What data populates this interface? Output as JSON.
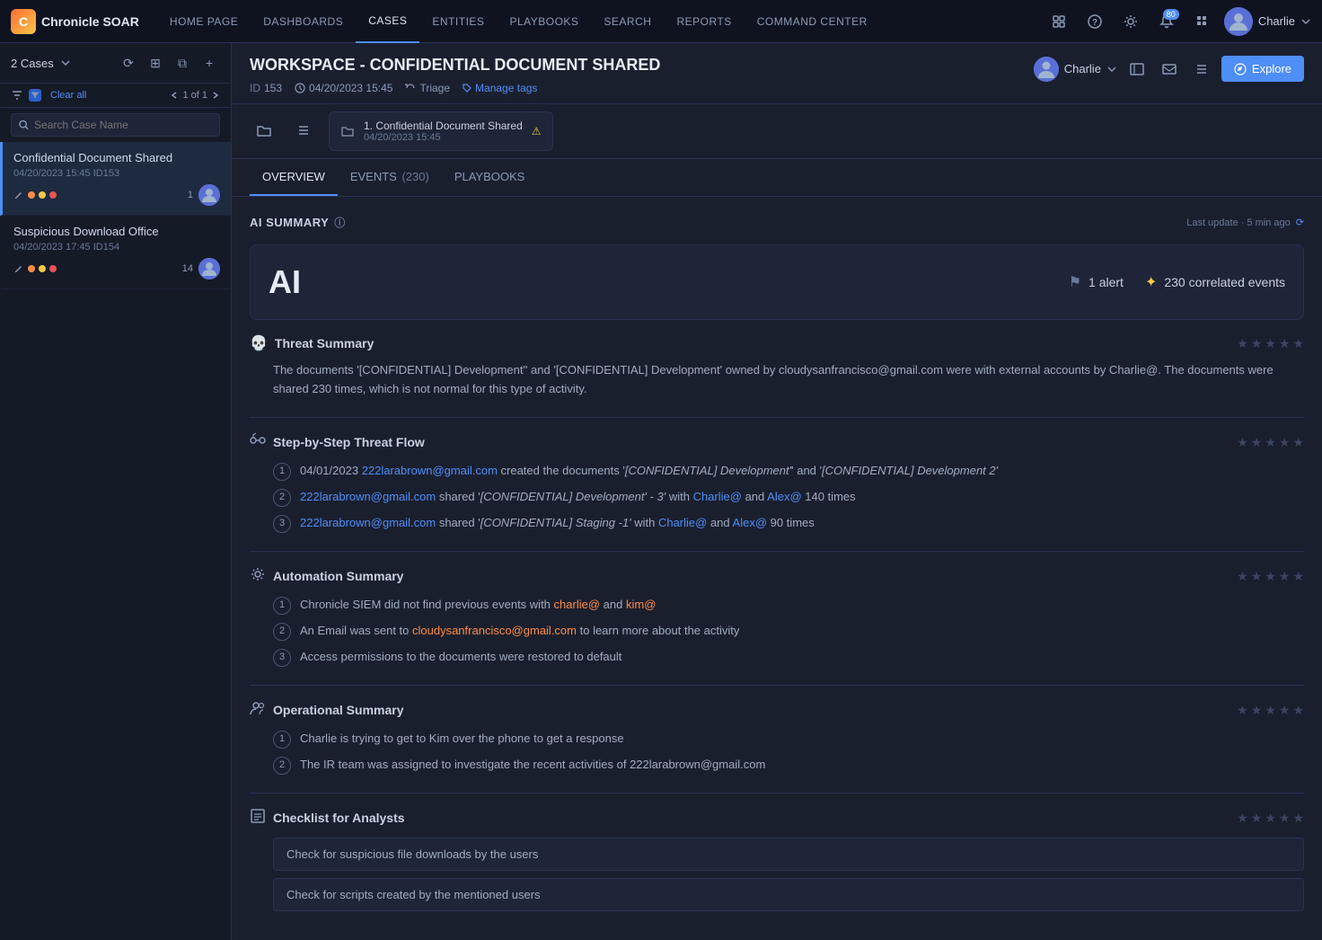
{
  "app": {
    "logo_text": "Chronicle SOAR",
    "logo_abbr": "C"
  },
  "nav": {
    "items": [
      {
        "id": "home",
        "label": "HOME PAGE"
      },
      {
        "id": "dashboards",
        "label": "DASHBOARDS"
      },
      {
        "id": "cases",
        "label": "CASES",
        "active": true
      },
      {
        "id": "entities",
        "label": "ENTITIES"
      },
      {
        "id": "playbooks",
        "label": "PLAYBOOKS"
      },
      {
        "id": "search",
        "label": "SEARCH"
      },
      {
        "id": "reports",
        "label": "REPORTS"
      },
      {
        "id": "command",
        "label": "COMMAND CENTER"
      }
    ],
    "icons": {
      "expand": "⤢",
      "help": "?",
      "settings": "⚙",
      "notifications": "🔔",
      "grid": "⋮⋮",
      "notification_badge": "80"
    },
    "user": {
      "name": "Charlie",
      "avatar_initials": "C"
    }
  },
  "sidebar": {
    "cases_count": "2 Cases",
    "filter_label": "Clear all",
    "pagination": "1 of 1",
    "search_placeholder": "Search Case Name",
    "cases": [
      {
        "title": "Confidential Document Shared",
        "date": "04/20/2023 15:45",
        "id": "ID153",
        "active": true,
        "count": 1,
        "tags": [
          "orange",
          "yellow",
          "red"
        ]
      },
      {
        "title": "Suspicious Download Office",
        "date": "04/20/2023 17:45",
        "id": "ID154",
        "active": false,
        "count": 14,
        "tags": [
          "orange",
          "yellow",
          "red"
        ]
      }
    ]
  },
  "workspace": {
    "title": "WORKSPACE - CONFIDENTIAL DOCUMENT SHARED",
    "id": "153",
    "datetime": "04/20/2023 15:45",
    "status": "Triage",
    "manage_tags": "Manage tags",
    "assigned_user": "Charlie",
    "explore_btn": "Explore"
  },
  "alert_card": {
    "title": "1. Confidential Document Shared",
    "time": "04/20/2023 15:45"
  },
  "tabs": [
    {
      "id": "overview",
      "label": "OVERVIEW",
      "active": true
    },
    {
      "id": "events",
      "label": "EVENTS (230)",
      "active": false
    },
    {
      "id": "playbooks",
      "label": "PLAYBOOKS",
      "active": false
    }
  ],
  "ai_summary": {
    "title": "AI SUMMARY",
    "last_update": "Last update · 5 min ago",
    "ai_label": "AI",
    "alert_count": "1 alert",
    "events_count": "230 correlated events"
  },
  "threat_summary": {
    "title": "Threat Summary",
    "content": "The documents '[CONFIDENTIAL] Development'' and '[CONFIDENTIAL] Development' owned by cloudysanfrancisco@gmail.com were  with external accounts by Charlie@. The documents were shared 230 times, which is not normal for this type of activity."
  },
  "step_flow": {
    "title": "Step-by-Step Threat Flow",
    "steps": [
      {
        "num": "1",
        "parts": [
          {
            "text": "04/01/2023 ",
            "type": "normal"
          },
          {
            "text": "222larabrown@gmail.com",
            "type": "link"
          },
          {
            "text": " created the documents '",
            "type": "normal"
          },
          {
            "text": "[CONFIDENTIAL] Development'",
            "type": "italic"
          },
          {
            "text": "' and '",
            "type": "normal"
          },
          {
            "text": "[CONFIDENTIAL] Development 2'",
            "type": "italic"
          }
        ],
        "full": "04/01/2023 222larabrown@gmail.com created the documents '[CONFIDENTIAL] Development'' and '[CONFIDENTIAL] Development 2'"
      },
      {
        "num": "2",
        "full": "222larabrown@gmail.com shared '[CONFIDENTIAL] Development' - 3' with Charlie@ and Alex@ 140 times"
      },
      {
        "num": "3",
        "full": "222larabrown@gmail.com shared '[CONFIDENTIAL] Staging -1' with Charlie@ and Alex@ 90 times"
      }
    ]
  },
  "automation_summary": {
    "title": "Automation Summary",
    "steps": [
      {
        "num": "1",
        "text": "Chronicle SIEM did not find previous events with charlie@ and kim@"
      },
      {
        "num": "2",
        "text": "An Email was sent to cloudysanfrancisco@gmail.com to learn more about the activity"
      },
      {
        "num": "3",
        "text": "Access permissions to the documents were restored to default"
      }
    ]
  },
  "operational_summary": {
    "title": "Operational Summary",
    "steps": [
      {
        "num": "1",
        "text": "Charlie is trying to get to Kim over the phone to get a response"
      },
      {
        "num": "2",
        "text": "The IR team was assigned to investigate the recent activities of 222larabrown@gmail.com"
      }
    ]
  },
  "checklist": {
    "title": "Checklist for Analysts",
    "items": [
      {
        "text": "Check for suspicious file downloads by the users"
      },
      {
        "text": "Check for scripts created by the mentioned users"
      }
    ]
  }
}
